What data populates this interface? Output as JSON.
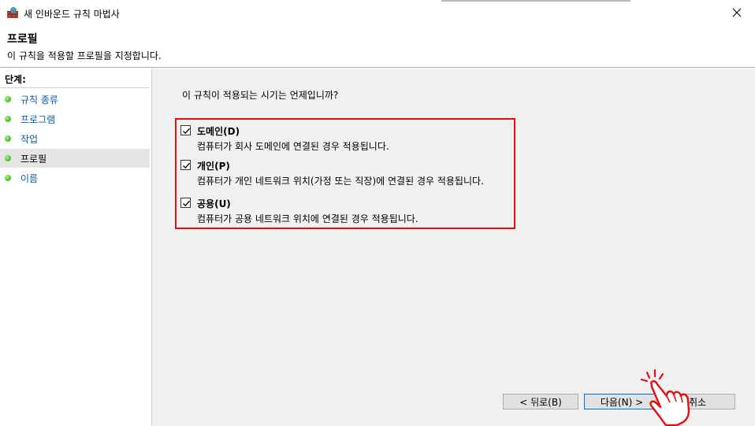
{
  "window": {
    "title": "새 인바운드 규칙 마법사"
  },
  "header": {
    "title": "프로필",
    "subtitle": "이 규칙을 적용할 프로필을 지정합니다."
  },
  "sidebar": {
    "heading": "단계:",
    "items": [
      {
        "label": "규칙 종류",
        "active": false
      },
      {
        "label": "프로그램",
        "active": false
      },
      {
        "label": "작업",
        "active": false
      },
      {
        "label": "프로필",
        "active": true
      },
      {
        "label": "이름",
        "active": false
      }
    ]
  },
  "main": {
    "question": "이 규칙이 적용되는 시기는 언제입니까?",
    "options": [
      {
        "title": "도메인(D)",
        "description": "컴퓨터가 회사 도메인에 연결된 경우 적용됩니다.",
        "checked": true
      },
      {
        "title": "개인(P)",
        "description": "컴퓨터가 개인 네트워크 위치(가정 또는 직장)에 연결된 경우 적용됩니다.",
        "checked": true
      },
      {
        "title": "공용(U)",
        "description": "컴퓨터가 공용 네트워크 위치에 연결된 경우 적용됩니다.",
        "checked": true
      }
    ]
  },
  "buttons": {
    "back": "< 뒤로(B)",
    "next": "다음(N) >",
    "cancel": "취소"
  },
  "colors": {
    "highlight": "#e01010",
    "link": "#0b5ca8",
    "step_dot": "#5fcf3c"
  }
}
